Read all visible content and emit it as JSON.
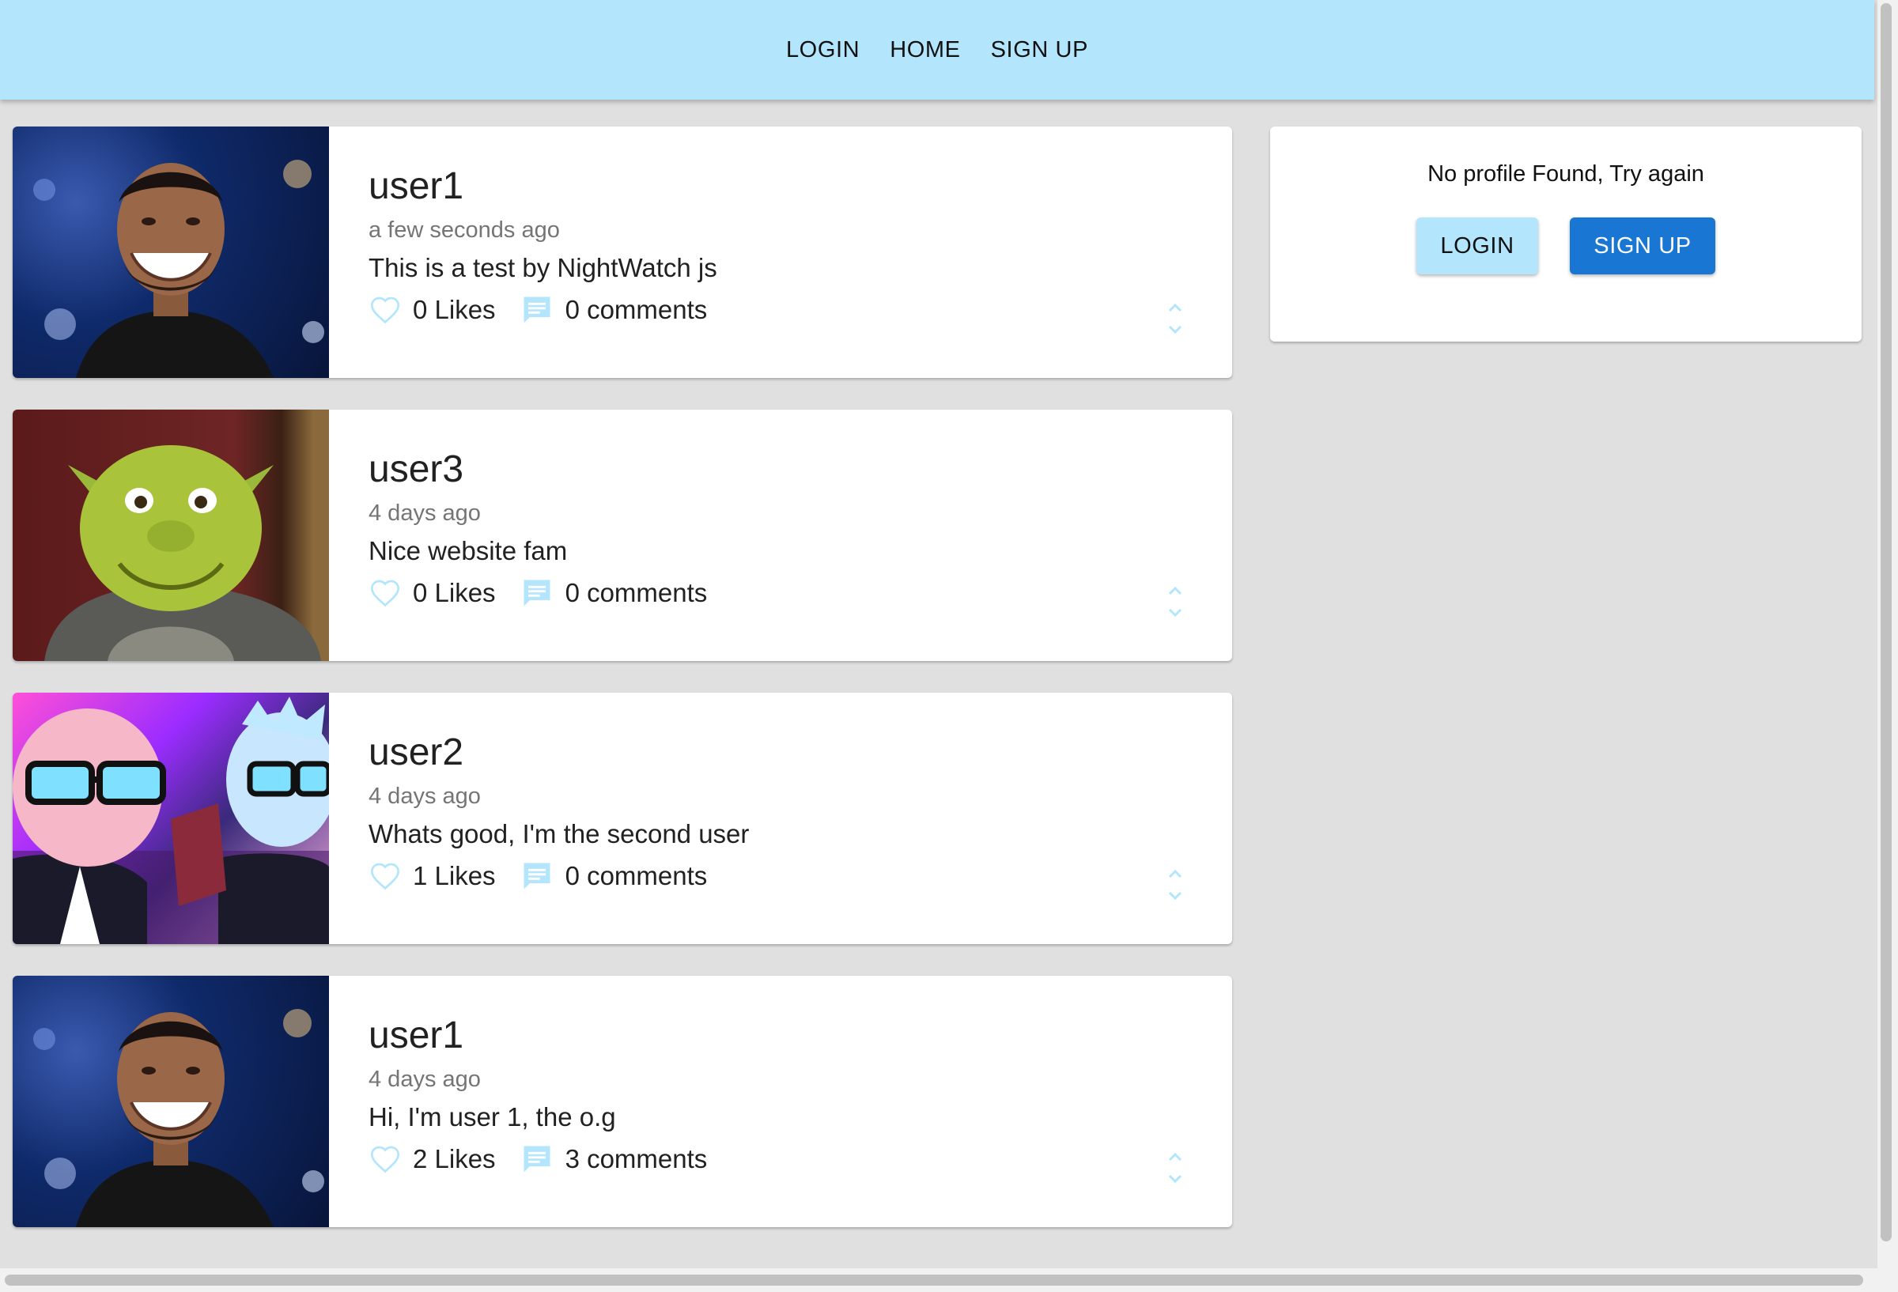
{
  "nav": {
    "login": "LOGIN",
    "home": "HOME",
    "signup": "SIGN UP"
  },
  "posts": [
    {
      "user": "user1",
      "time": "a few seconds ago",
      "text": "This is a test by NightWatch js",
      "likes": "0 Likes",
      "comments": "0 comments",
      "image": "drake-photo"
    },
    {
      "user": "user3",
      "time": "4 days ago",
      "text": "Nice website fam",
      "likes": "0 Likes",
      "comments": "0 comments",
      "image": "shrek-photo"
    },
    {
      "user": "user2",
      "time": "4 days ago",
      "text": "Whats good, I'm the second user",
      "likes": "1 Likes",
      "comments": "0 comments",
      "image": "rick-and-morty-art"
    },
    {
      "user": "user1",
      "time": "4 days ago",
      "text": "Hi, I'm user 1, the o.g",
      "likes": "2 Likes",
      "comments": "3 comments",
      "image": "drake-photo"
    }
  ],
  "profile_panel": {
    "message": "No profile Found, Try again",
    "login_label": "LOGIN",
    "signup_label": "SIGN UP"
  },
  "icons": {
    "like": "heart-outline-icon",
    "comment": "comment-icon",
    "expand": "unfold-more-icon"
  },
  "colors": {
    "appbar": "#b3e5fc",
    "primary": "#1976d2",
    "icon_light_blue": "#b3e5fc",
    "background": "#e0e0e0"
  }
}
